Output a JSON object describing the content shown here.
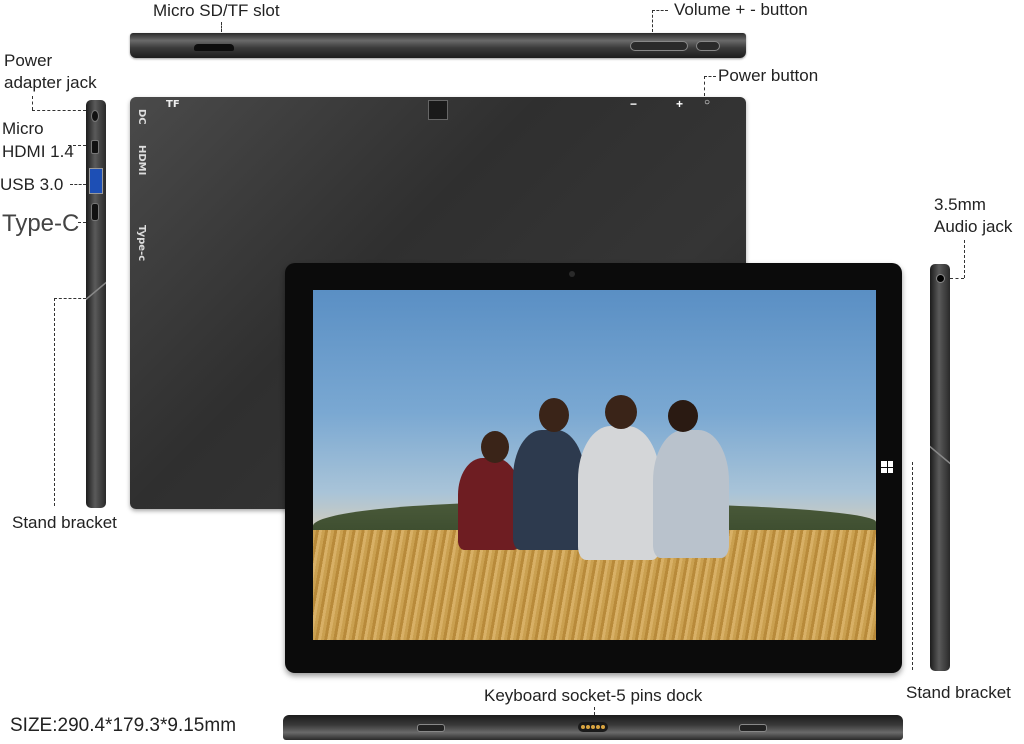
{
  "labels": {
    "micro_sd": "Micro SD/TF slot",
    "volume": "Volume + - button",
    "power_adapter_1": "Power",
    "power_adapter_2": "adapter jack",
    "power_button": "Power button",
    "micro_hdmi_1": "Micro",
    "micro_hdmi_2": "HDMI 1.4",
    "usb": "USB 3.0",
    "type_c": "Type-C",
    "stand_left": "Stand bracket",
    "audio_1": "3.5mm",
    "audio_2": "Audio jack",
    "stand_right": "Stand bracket",
    "keyboard": "Keyboard socket-5 pins dock",
    "size": "SIZE:290.4*179.3*9.15mm"
  },
  "back_print": {
    "tf": "TF",
    "dc": "DC",
    "hdmi": "HDMI",
    "typec": "Type-c",
    "minus": "−",
    "plus": "+",
    "power": "○"
  },
  "icons": [
    "windows-logo-icon"
  ]
}
